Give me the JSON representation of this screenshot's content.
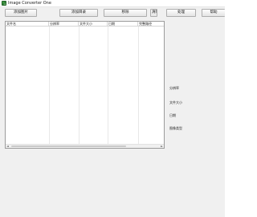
{
  "window": {
    "title": "Image Converter One",
    "app_icon": "image-converter-app-icon"
  },
  "toolbar": {
    "add_image_label": "添加图片",
    "add_folder_label": "添加目录",
    "remove_label": "移除",
    "clear_label": "清除",
    "convert_label": "处理",
    "help_label": "帮助"
  },
  "file_list": {
    "columns": [
      "文件名",
      "分辨率",
      "文件大小",
      "日期",
      "完整路径"
    ],
    "rows": []
  },
  "details": {
    "resolution_label": "分辨率",
    "file_size_label": "文件大小",
    "date_label": "日期",
    "image_type_label": "图像类型"
  },
  "scrollbar": {
    "left_arrow": "◄",
    "right_arrow": "►"
  }
}
